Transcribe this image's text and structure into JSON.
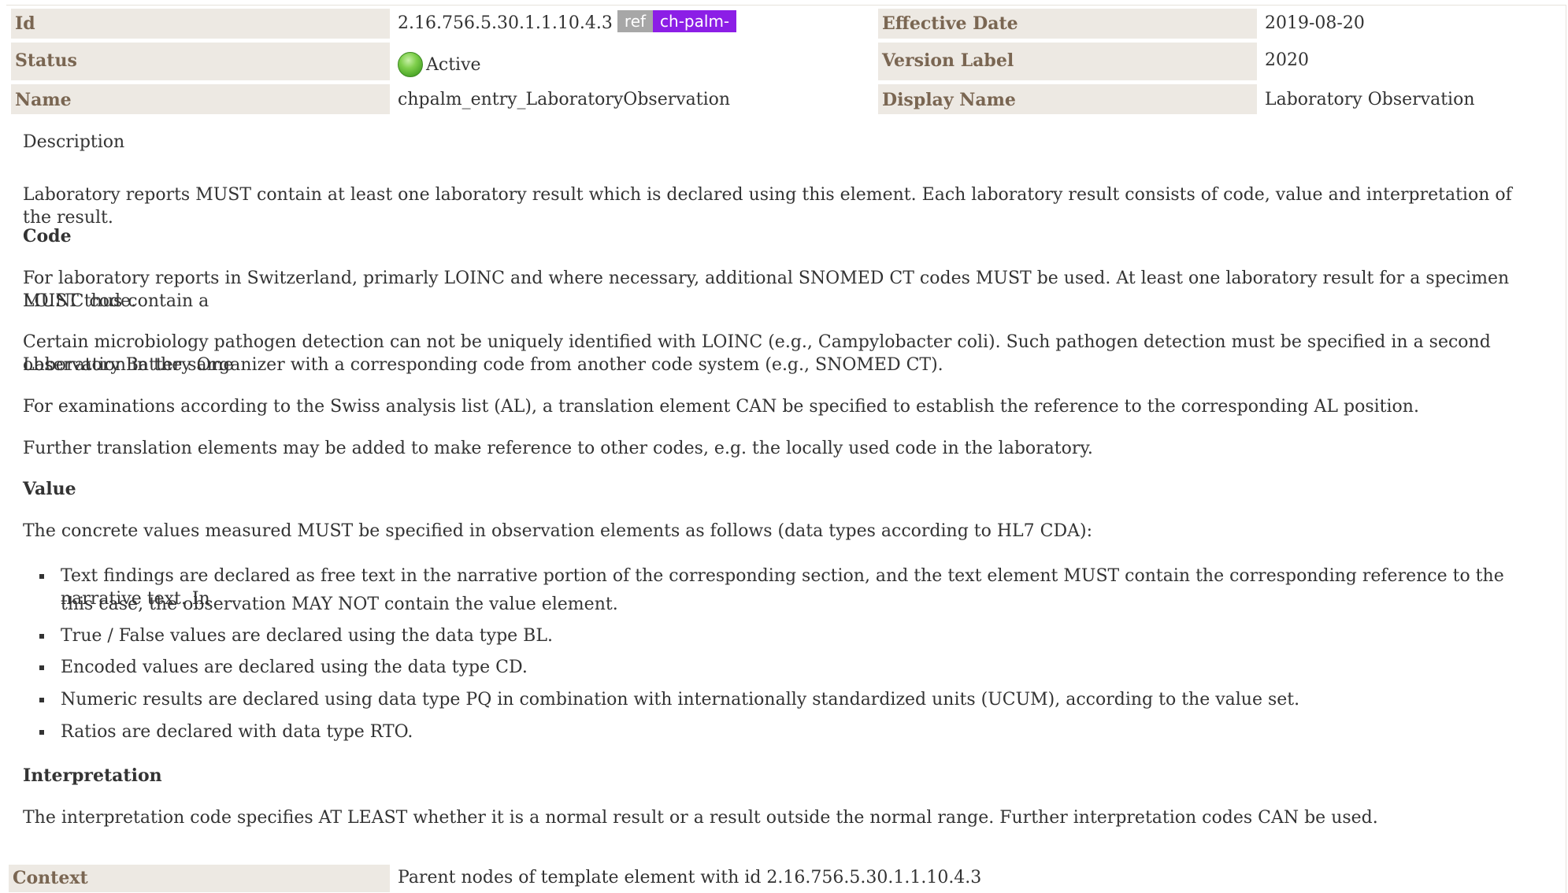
{
  "header": {
    "id_label": "Id",
    "id_value": "2.16.756.5.30.1.1.10.4.3",
    "ref_badge": "ref",
    "prefix_badge": "ch-palm-",
    "effective_date_label": "Effective Date",
    "effective_date_value": "2019-08-20",
    "status_label": "Status",
    "status_value": "Active",
    "status_color": "#5cb832",
    "version_label_label": "Version Label",
    "version_label_value": "2020",
    "name_label": "Name",
    "name_value": "chpalm_entry_LaboratoryObservation",
    "display_name_label": "Display Name",
    "display_name_value": "Laboratory Observation"
  },
  "description": {
    "label": "Description",
    "intro": "Laboratory reports MUST contain at least one laboratory result which is declared using this element. Each laboratory result consists of code, value and interpretation of the result.",
    "code_heading": "Code",
    "code_p1_line1": "For laboratory reports in Switzerland, primarly LOINC and where necessary, additional SNOMED CT codes MUST be used. At least one laboratory result for a specimen MUST thus contain a",
    "code_p1_line2": "LOINC code.",
    "code_p2_line1": "Certain microbiology pathogen detection can not be uniquely identified with LOINC (e.g., Campylobacter coli). Such pathogen detection must be specified in a second observation in the same",
    "code_p2_line2": "Laboratory Battery Organizer with a corresponding code from another code system (e.g., SNOMED CT).",
    "code_p3": "For examinations according to the Swiss analysis list (AL), a translation element CAN be specified to establish the reference to the corresponding AL position.",
    "code_p4": "Further translation elements may be added to make reference to other codes, e.g. the locally used code in the laboratory.",
    "value_heading": "Value",
    "value_intro": "The concrete values measured MUST be specified in observation elements as follows (data types according to HL7 CDA):",
    "bullets": [
      "Text findings are declared as free text in the narrative portion of the corresponding section, and the text element MUST contain the corresponding reference to the narrative text. In",
      "this case, the observation MAY NOT contain the value element.",
      "True / False values are declared using the data type BL.",
      "Encoded values are declared using the data type CD.",
      "Numeric results are declared using data type PQ in combination with internationally standardized units (UCUM), according to the value set.",
      "Ratios are declared with data type RTO."
    ],
    "interpretation_heading": "Interpretation",
    "interpretation_text": "The interpretation code specifies AT LEAST whether it is a normal result or a result outside the normal range. Further interpretation codes CAN be used."
  },
  "context": {
    "label": "Context",
    "value": "Parent nodes of template element with id 2.16.756.5.30.1.1.10.4.3"
  }
}
